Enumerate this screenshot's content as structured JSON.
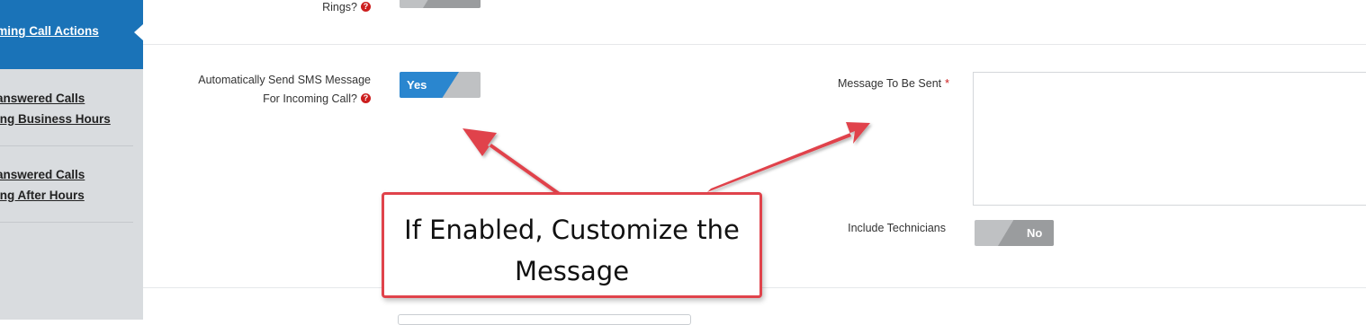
{
  "sidebar": {
    "active_item": "oming Call Actions",
    "items": [
      {
        "line1": "answered Calls",
        "line2": "ing Business Hours"
      },
      {
        "line1": "answered Calls",
        "line2": "ing After Hours"
      }
    ]
  },
  "form": {
    "rings_label": "Rings?",
    "sms_label_line1": "Automatically Send SMS Message",
    "sms_label_line2": "For Incoming Call?",
    "sms_toggle": {
      "value": "Yes",
      "state": "on"
    },
    "message_label": "Message To Be Sent",
    "message_required_mark": "*",
    "message_value": "",
    "technicians_label": "Include Technicians",
    "technicians_toggle": {
      "value": "No",
      "state": "off"
    }
  },
  "icons": {
    "help": "question-circle-icon"
  },
  "annotation": {
    "text_line1": "If Enabled, Customize the",
    "text_line2": "Message",
    "color": "#e0434b"
  },
  "colors": {
    "accent": "#1a73b8",
    "toggle_on": "#2a86cf",
    "required": "#cc1e1e"
  }
}
